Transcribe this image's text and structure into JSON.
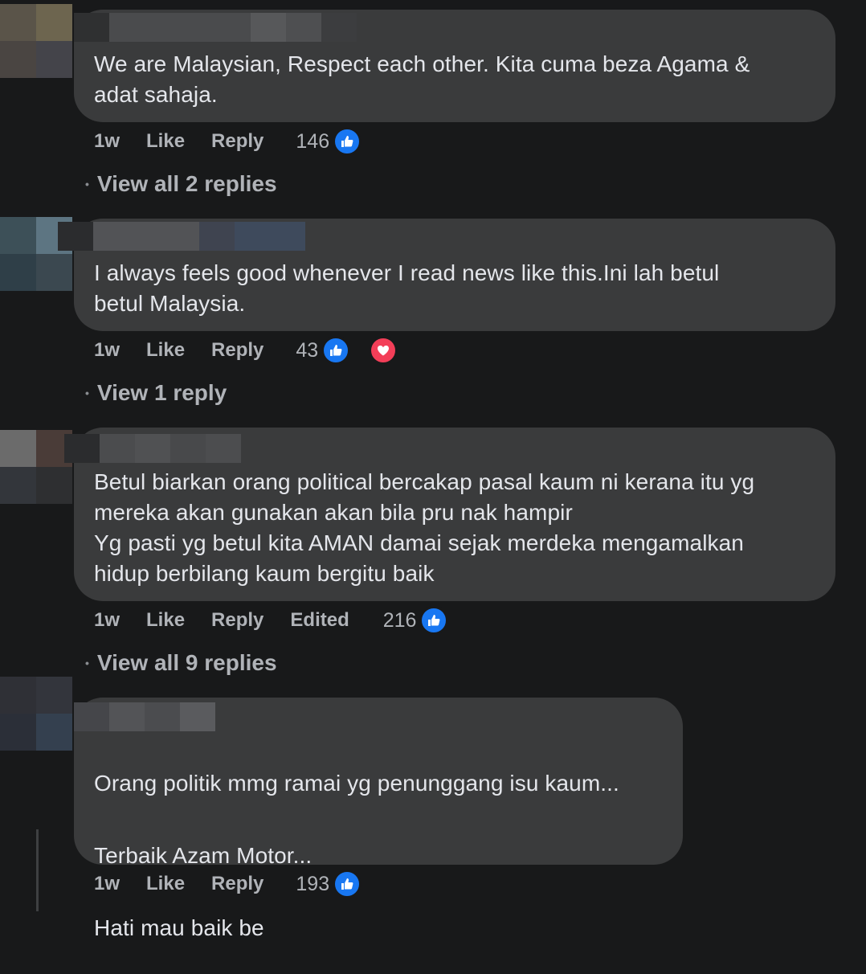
{
  "comments": [
    {
      "text": "We are Malaysian, Respect each other. Kita cuma beza Agama &\nadat sahaja.",
      "time": "1w",
      "like_label": "Like",
      "reply_label": "Reply",
      "reaction_count": "146",
      "reactions": [
        "like-icon"
      ],
      "view_replies": "View all 2 replies"
    },
    {
      "text": "I always feels good whenever I read news like this.Ini lah betul\nbetul Malaysia.",
      "time": "1w",
      "like_label": "Like",
      "reply_label": "Reply",
      "reaction_count": "43",
      "reactions": [
        "like-icon",
        "love-icon"
      ],
      "view_replies": "View 1 reply"
    },
    {
      "text": "Betul biarkan orang political bercakap pasal kaum ni kerana itu yg\nmereka akan gunakan akan bila pru nak hampir\nYg pasti yg betul kita AMAN damai sejak merdeka mengamalkan\nhidup berbilang kaum bergitu baik",
      "time": "1w",
      "like_label": "Like",
      "reply_label": "Reply",
      "edited_label": "Edited",
      "reaction_count": "216",
      "reactions": [
        "like-icon"
      ],
      "view_replies": "View all 9 replies"
    },
    {
      "paragraphs": [
        "Orang politik mmg ramai yg penunggang isu kaum...",
        "Terbaik Azam Motor...",
        "Hati mau baik be"
      ],
      "time": "1w",
      "like_label": "Like",
      "reply_label": "Reply",
      "reaction_count": "193",
      "reactions": [
        "like-icon"
      ]
    }
  ],
  "colors": {
    "background": "#18191a",
    "bubble": "#3a3b3c",
    "like_blue": "#1877f2",
    "love_red": "#f33e58",
    "secondary_text": "#b0b3b8"
  }
}
